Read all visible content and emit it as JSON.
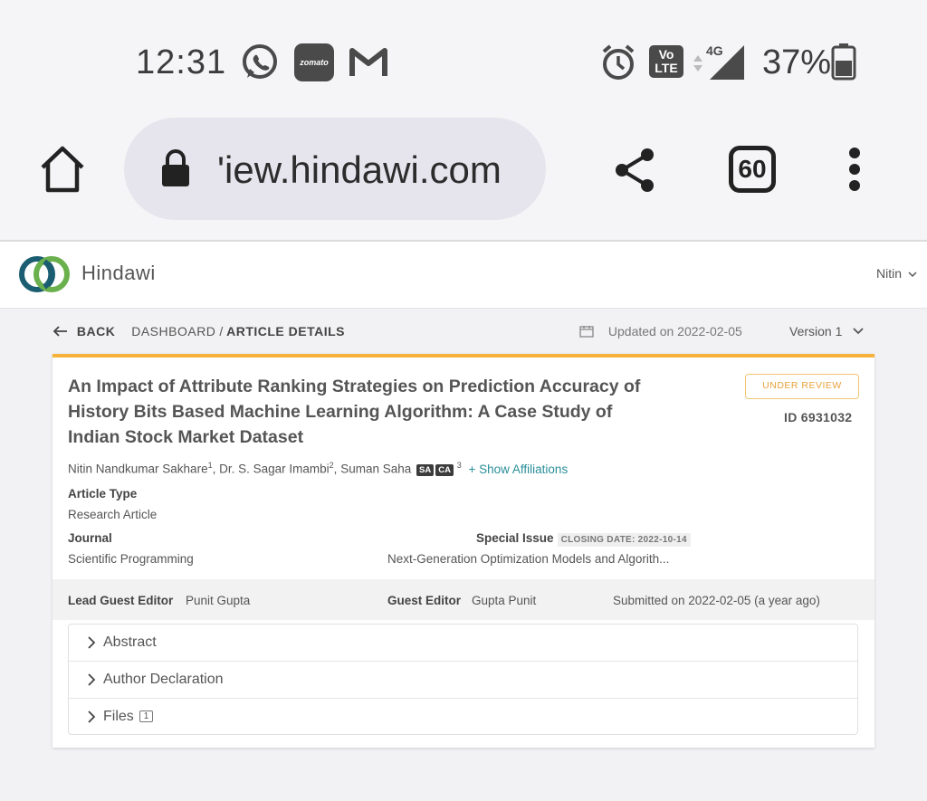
{
  "status_bar": {
    "time": "12:31",
    "notification_icons": [
      "whatsapp-icon",
      "zomato-icon",
      "gmail-icon"
    ],
    "zomato_label": "zomato",
    "volte_label_1": "Vo",
    "volte_label_2": "LTE",
    "network": "4G",
    "battery": "37%"
  },
  "browser": {
    "url": "'iew.hindawi.com",
    "tab_count": "60"
  },
  "app": {
    "brand": "Hindawi",
    "user": "Nitin"
  },
  "nav": {
    "back": "BACK",
    "dashboard": "DASHBOARD",
    "separator": "/",
    "current": "ARTICLE DETAILS",
    "updated": "Updated on 2022-02-05",
    "version": "Version 1"
  },
  "article": {
    "title": "An Impact of Attribute Ranking Strategies on Prediction Accuracy of History Bits Based Machine Learning Algorithm: A Case Study of Indian Stock Market Dataset",
    "status": "UNDER REVIEW",
    "id": "ID 6931032",
    "authors": [
      {
        "name": "Nitin Nandkumar Sakhare",
        "sup": "1"
      },
      {
        "name": "Dr. S. Sagar Imambi",
        "sup": "2"
      },
      {
        "name": "Suman Saha",
        "sup": "3"
      }
    ],
    "author_tags": [
      "SA",
      "CA"
    ],
    "show_affiliations": "+ Show Affiliations",
    "article_type_label": "Article Type",
    "article_type": "Research Article",
    "journal_label": "Journal",
    "journal": "Scientific Programming",
    "special_issue_label": "Special Issue",
    "closing_date": "CLOSING DATE: 2022-10-14",
    "special_issue": "Next-Generation Optimization Models and Algorith...",
    "lead_editor_label": "Lead Guest Editor",
    "lead_editor": "Punit Gupta",
    "guest_editor_label": "Guest Editor",
    "guest_editor": "Gupta Punit",
    "submitted": "Submitted on 2022-02-05 (a year ago)"
  },
  "sections": [
    {
      "label": "Abstract"
    },
    {
      "label": "Author Declaration"
    },
    {
      "label": "Files",
      "count": "1"
    }
  ],
  "colors": {
    "accent": "#f7b23b",
    "link": "#2a8e9a",
    "badge": "#e8a23c"
  }
}
